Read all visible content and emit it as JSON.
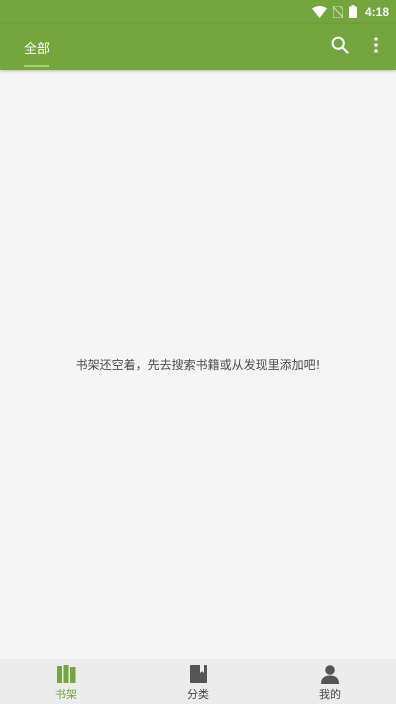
{
  "status_bar": {
    "time": "4:18",
    "icons": [
      "wifi-icon",
      "no-sim-icon",
      "battery-icon"
    ]
  },
  "app_bar": {
    "tab_label": "全部",
    "actions": [
      "search-icon",
      "more-vert-icon"
    ]
  },
  "main": {
    "empty_message": "书架还空着，先去搜索书籍或从发现里添加吧!"
  },
  "bottom_nav": {
    "items": [
      {
        "label": "书架",
        "icon": "bookshelf-icon",
        "active": true
      },
      {
        "label": "分类",
        "icon": "category-book-icon",
        "active": false
      },
      {
        "label": "我的",
        "icon": "person-icon",
        "active": false
      }
    ]
  },
  "colors": {
    "primary": "#75a53f",
    "indicator": "#a8d46f",
    "background": "#f5f5f5",
    "nav_background": "#ececec",
    "inactive_icon": "#555555"
  }
}
